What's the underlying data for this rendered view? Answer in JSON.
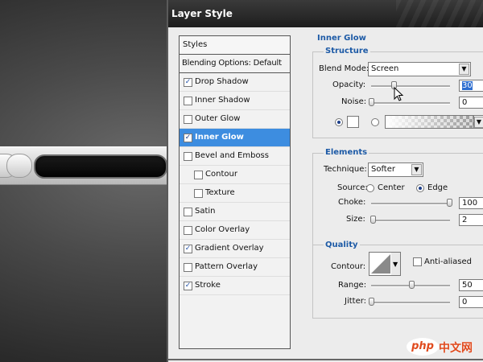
{
  "window": {
    "title": "Layer Style"
  },
  "styles_panel": {
    "header": "Styles",
    "blending_options": "Blending Options: Default",
    "items": [
      {
        "label": "Drop Shadow",
        "checked": true,
        "sub": false,
        "selected": false
      },
      {
        "label": "Inner Shadow",
        "checked": false,
        "sub": false,
        "selected": false
      },
      {
        "label": "Outer Glow",
        "checked": false,
        "sub": false,
        "selected": false
      },
      {
        "label": "Inner Glow",
        "checked": true,
        "sub": false,
        "selected": true
      },
      {
        "label": "Bevel and Emboss",
        "checked": false,
        "sub": false,
        "selected": false
      },
      {
        "label": "Contour",
        "checked": false,
        "sub": true,
        "selected": false
      },
      {
        "label": "Texture",
        "checked": false,
        "sub": true,
        "selected": false
      },
      {
        "label": "Satin",
        "checked": false,
        "sub": false,
        "selected": false
      },
      {
        "label": "Color Overlay",
        "checked": false,
        "sub": false,
        "selected": false
      },
      {
        "label": "Gradient Overlay",
        "checked": true,
        "sub": false,
        "selected": false
      },
      {
        "label": "Pattern Overlay",
        "checked": false,
        "sub": false,
        "selected": false
      },
      {
        "label": "Stroke",
        "checked": true,
        "sub": false,
        "selected": false
      }
    ]
  },
  "inner_glow": {
    "title": "Inner Glow",
    "structure": {
      "title": "Structure",
      "blend_mode_label": "Blend Mode:",
      "blend_mode": "Screen",
      "opacity_label": "Opacity:",
      "opacity": "30",
      "noise_label": "Noise:",
      "noise": "0"
    },
    "elements": {
      "title": "Elements",
      "technique_label": "Technique:",
      "technique": "Softer",
      "source_label": "Source:",
      "source_center": "Center",
      "source_edge": "Edge",
      "choke_label": "Choke:",
      "choke": "100",
      "size_label": "Size:",
      "size": "2"
    },
    "quality": {
      "title": "Quality",
      "contour_label": "Contour:",
      "anti_aliased_label": "Anti-aliased",
      "range_label": "Range:",
      "range": "50",
      "jitter_label": "Jitter:",
      "jitter": "0"
    }
  },
  "colors": {
    "accent": "#3d8de0",
    "section_title": "#1d5aa6",
    "titlebar": "#262626"
  },
  "watermark": {
    "php": "php",
    "cn": "中文网"
  }
}
